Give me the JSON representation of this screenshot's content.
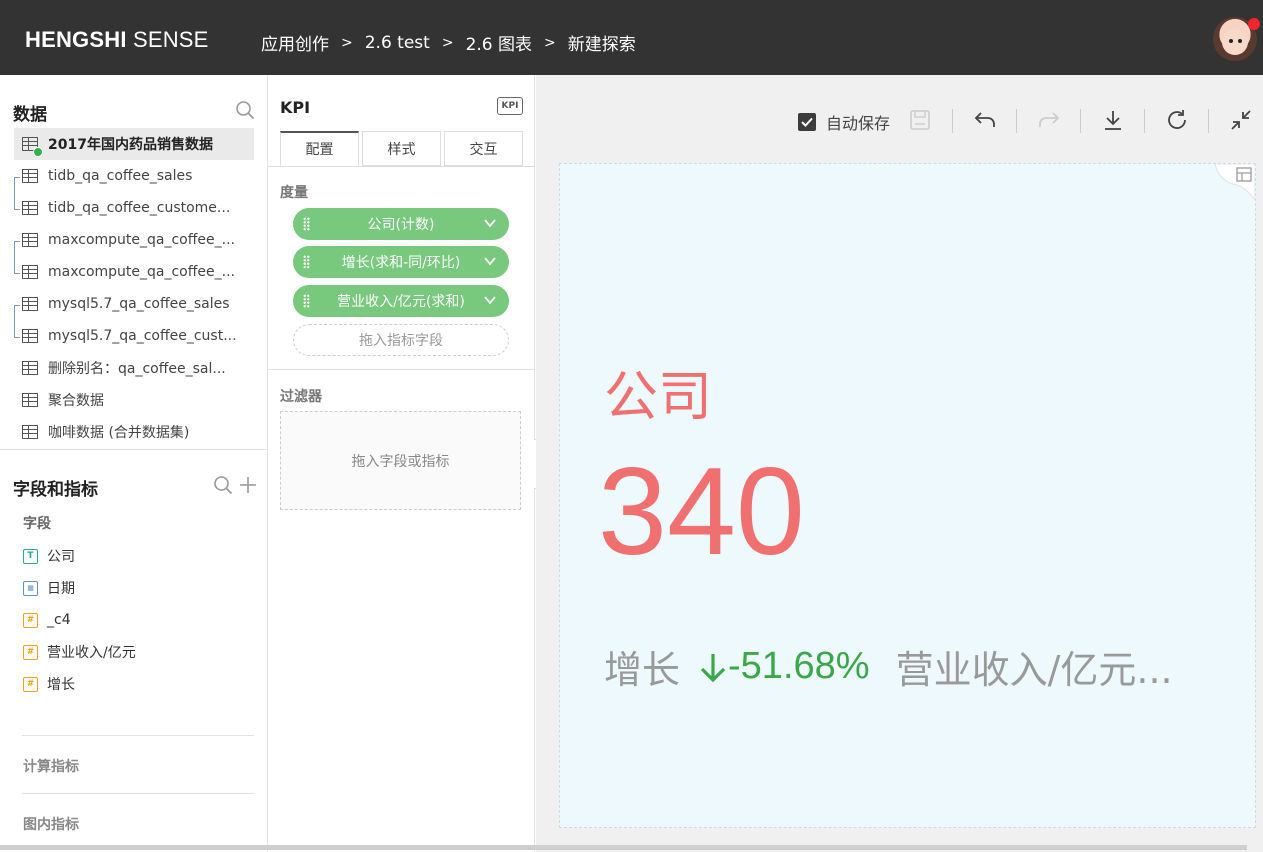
{
  "header": {
    "brand_bold": "HENGSHI",
    "brand_rest": " SENSE",
    "breadcrumbs": [
      "应用创作",
      "2.6 test",
      "2.6 图表",
      "新建探索"
    ],
    "sep": ">"
  },
  "data_panel": {
    "title": "数据",
    "datasets": [
      "2017年国内药品销售数据",
      "tidb_qa_coffee_sales",
      "tidb_qa_coffee_custome...",
      "maxcompute_qa_coffee_...",
      "maxcompute_qa_coffee_...",
      "mysql5.7_qa_coffee_sales",
      "mysql5.7_qa_coffee_cust...",
      "删除别名：qa_coffee_sal...",
      "聚合数据",
      "咖啡数据 (合并数据集)"
    ]
  },
  "fields_panel": {
    "title": "字段和指标",
    "group_fields": "字段",
    "fields": [
      {
        "type": "T",
        "name": "公司"
      },
      {
        "type": "date",
        "name": "日期"
      },
      {
        "type": "#",
        "name": "_c4"
      },
      {
        "type": "#",
        "name": "营业收入/亿元"
      },
      {
        "type": "#",
        "name": "增长"
      }
    ],
    "calc_metrics": "计算指标",
    "chart_metrics": "图内指标"
  },
  "config_panel": {
    "title": "KPI",
    "badge": "KPI",
    "tabs": [
      "配置",
      "样式",
      "交互"
    ],
    "measures_label": "度量",
    "measures": [
      "公司(计数)",
      "增长(求和-同/环比)",
      "营业收入/亿元(求和)"
    ],
    "measure_drop": "拖入指标字段",
    "filter_label": "过滤器",
    "filter_drop": "拖入字段或指标"
  },
  "toolbar": {
    "autosave_label": "自动保存",
    "autosave_checked": true
  },
  "kpi": {
    "name": "公司",
    "value": "340",
    "sub_label": "增长",
    "change": "-51.68%",
    "change_direction": "down",
    "second_label": "营业收入/亿元...",
    "colors": {
      "main": "#f07070",
      "change": "#3aa84a",
      "sub": "#999999",
      "card_bg": "#edf9fd"
    }
  }
}
